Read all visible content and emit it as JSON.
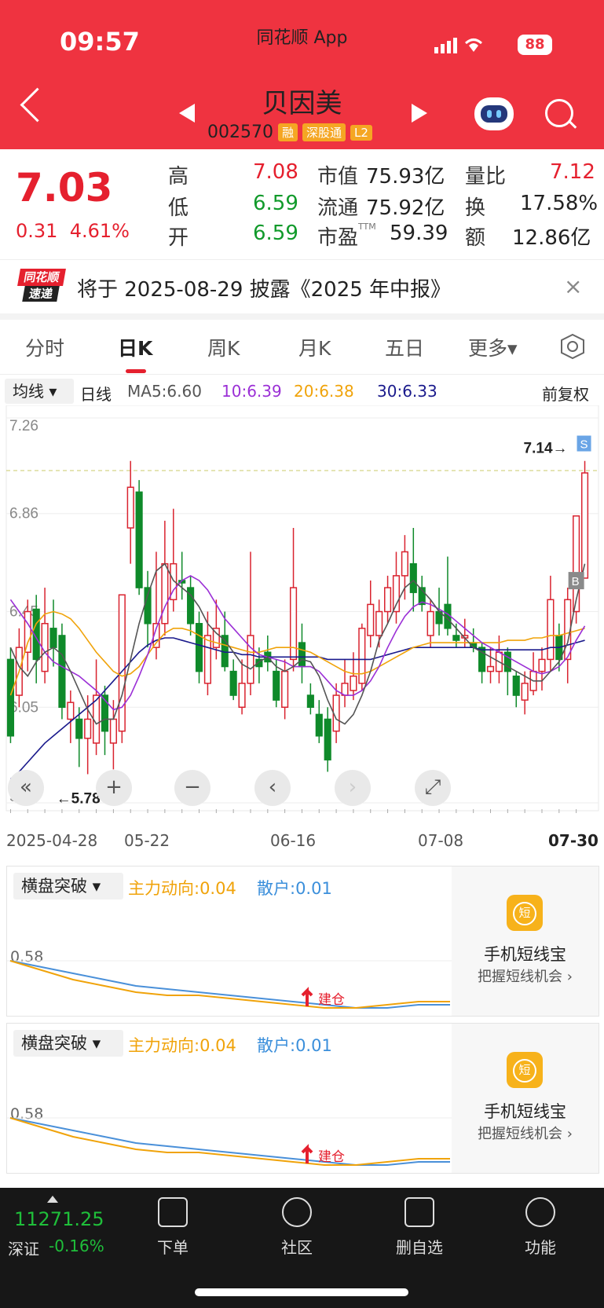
{
  "status_bar": {
    "time": "09:57",
    "battery": "88",
    "app": "同花顺 App"
  },
  "header": {
    "name": "贝因美",
    "code": "002570",
    "tags": [
      "融",
      "深股通",
      "L2"
    ]
  },
  "quote": {
    "price": "7.03",
    "change": "0.31",
    "change_pct": "4.61%",
    "high_label": "高",
    "high": "7.08",
    "low_label": "低",
    "low": "6.59",
    "open_label": "开",
    "open": "6.59",
    "mcap_label": "市值",
    "mcap": "75.93亿",
    "float_label": "流通",
    "float": "75.92亿",
    "pe_label": "市盈",
    "pe_sup": "TTM",
    "pe": "59.39",
    "vol_ratio_label": "量比",
    "vol_ratio": "7.12",
    "turnover_label": "换",
    "turnover": "17.58%",
    "amount_label": "额",
    "amount": "12.86亿"
  },
  "notice": {
    "logo_top": "同花顺",
    "logo_bottom": "速递",
    "text": "将于 2025-08-29 披露《2025 年中报》",
    "close": "×"
  },
  "tabs": [
    "分时",
    "日K",
    "周K",
    "月K",
    "五日",
    "更多▾"
  ],
  "ma_bar": {
    "selector": "均线",
    "period": "日线",
    "ma5": "MA5:6.60",
    "ma10": "10:6.39",
    "ma20": "20:6.38",
    "ma30": "30:6.33",
    "adjust": "前复权",
    "colors": {
      "ma5": "#555555",
      "ma10": "#9b2fd6",
      "ma20": "#f0a30a",
      "ma30": "#1a1a8c"
    }
  },
  "chart_data": {
    "type": "candlestick",
    "y_ticks": [
      "7.26",
      "6.86",
      "6.45",
      "6.05",
      "5.65"
    ],
    "x_labels": [
      "2025-04-28",
      "05-22",
      "06-16",
      "07-08",
      "07-30"
    ],
    "max_marker": "7.14→",
    "min_marker": "←5.78",
    "reference_price": 7.04,
    "buy_marker": "B",
    "sell_marker": "S",
    "candles": [
      {
        "o": 6.25,
        "c": 5.93,
        "h": 6.3,
        "l": 5.9
      },
      {
        "o": 6.1,
        "c": 6.3,
        "h": 6.38,
        "l": 6.05
      },
      {
        "o": 6.28,
        "c": 6.45,
        "h": 6.5,
        "l": 6.2
      },
      {
        "o": 6.46,
        "c": 6.25,
        "h": 6.52,
        "l": 6.15
      },
      {
        "o": 6.2,
        "c": 6.4,
        "h": 6.55,
        "l": 6.15
      },
      {
        "o": 6.38,
        "c": 6.3,
        "h": 6.5,
        "l": 6.22
      },
      {
        "o": 6.35,
        "c": 6.05,
        "h": 6.4,
        "l": 6.0
      },
      {
        "o": 6.0,
        "c": 6.07,
        "h": 6.12,
        "l": 5.9
      },
      {
        "o": 6.0,
        "c": 5.92,
        "h": 6.05,
        "l": 5.8
      },
      {
        "o": 5.92,
        "c": 6.0,
        "h": 6.1,
        "l": 5.77
      },
      {
        "o": 5.9,
        "c": 6.1,
        "h": 6.25,
        "l": 5.85
      },
      {
        "o": 6.1,
        "c": 5.95,
        "h": 6.14,
        "l": 5.85
      },
      {
        "o": 5.9,
        "c": 6.0,
        "h": 6.08,
        "l": 5.79
      },
      {
        "o": 5.95,
        "c": 6.52,
        "h": 6.52,
        "l": 5.9
      },
      {
        "o": 6.8,
        "c": 6.97,
        "h": 7.08,
        "l": 6.65
      },
      {
        "o": 6.95,
        "c": 6.55,
        "h": 7.0,
        "l": 6.52
      },
      {
        "o": 6.55,
        "c": 6.4,
        "h": 6.62,
        "l": 6.3
      },
      {
        "o": 6.3,
        "c": 6.4,
        "h": 6.7,
        "l": 6.25
      },
      {
        "o": 6.4,
        "c": 6.65,
        "h": 6.83,
        "l": 6.35
      },
      {
        "o": 6.5,
        "c": 6.65,
        "h": 6.88,
        "l": 6.45
      },
      {
        "o": 6.58,
        "c": 6.57,
        "h": 6.7,
        "l": 6.5
      },
      {
        "o": 6.55,
        "c": 6.4,
        "h": 6.6,
        "l": 6.35
      },
      {
        "o": 6.4,
        "c": 6.2,
        "h": 6.45,
        "l": 6.15
      },
      {
        "o": 6.15,
        "c": 6.35,
        "h": 6.45,
        "l": 6.1
      },
      {
        "o": 6.3,
        "c": 6.38,
        "h": 6.5,
        "l": 6.25
      },
      {
        "o": 6.35,
        "c": 6.22,
        "h": 6.45,
        "l": 6.2
      },
      {
        "o": 6.2,
        "c": 6.1,
        "h": 6.25,
        "l": 6.08
      },
      {
        "o": 6.05,
        "c": 6.15,
        "h": 6.25,
        "l": 6.02
      },
      {
        "o": 6.15,
        "c": 6.35,
        "h": 6.7,
        "l": 6.1
      },
      {
        "o": 6.25,
        "c": 6.22,
        "h": 6.3,
        "l": 6.15
      },
      {
        "o": 6.28,
        "c": 6.24,
        "h": 6.35,
        "l": 6.2
      },
      {
        "o": 6.2,
        "c": 6.08,
        "h": 6.25,
        "l": 6.05
      },
      {
        "o": 6.05,
        "c": 6.2,
        "h": 6.25,
        "l": 6.0
      },
      {
        "o": 6.25,
        "c": 6.55,
        "h": 6.8,
        "l": 6.2
      },
      {
        "o": 6.32,
        "c": 6.22,
        "h": 6.4,
        "l": 6.15
      },
      {
        "o": 6.1,
        "c": 6.05,
        "h": 6.15,
        "l": 6.02
      },
      {
        "o": 6.02,
        "c": 5.93,
        "h": 6.08,
        "l": 5.9
      },
      {
        "o": 6.0,
        "c": 5.83,
        "h": 6.05,
        "l": 5.78
      },
      {
        "o": 5.95,
        "c": 6.1,
        "h": 6.15,
        "l": 5.9
      },
      {
        "o": 6.1,
        "c": 6.15,
        "h": 6.25,
        "l": 6.05
      },
      {
        "o": 6.12,
        "c": 6.18,
        "h": 6.28,
        "l": 6.08
      },
      {
        "o": 6.15,
        "c": 6.38,
        "h": 6.4,
        "l": 6.12
      },
      {
        "o": 6.35,
        "c": 6.48,
        "h": 6.58,
        "l": 6.3
      },
      {
        "o": 6.35,
        "c": 6.45,
        "h": 6.5,
        "l": 6.3
      },
      {
        "o": 6.45,
        "c": 6.55,
        "h": 6.6,
        "l": 6.4
      },
      {
        "o": 6.45,
        "c": 6.6,
        "h": 6.7,
        "l": 6.4
      },
      {
        "o": 6.6,
        "c": 6.7,
        "h": 6.77,
        "l": 6.5
      },
      {
        "o": 6.65,
        "c": 6.53,
        "h": 6.8,
        "l": 6.45
      },
      {
        "o": 6.55,
        "c": 6.48,
        "h": 6.6,
        "l": 6.45
      },
      {
        "o": 6.35,
        "c": 6.45,
        "h": 6.5,
        "l": 6.3
      },
      {
        "o": 6.45,
        "c": 6.4,
        "h": 6.55,
        "l": 6.35
      },
      {
        "o": 6.48,
        "c": 6.38,
        "h": 6.68,
        "l": 6.35
      },
      {
        "o": 6.35,
        "c": 6.33,
        "h": 6.4,
        "l": 6.3
      },
      {
        "o": 6.34,
        "c": 6.35,
        "h": 6.42,
        "l": 6.3
      },
      {
        "o": 6.32,
        "c": 6.3,
        "h": 6.38,
        "l": 6.28
      },
      {
        "o": 6.3,
        "c": 6.2,
        "h": 6.32,
        "l": 6.15
      },
      {
        "o": 6.2,
        "c": 6.22,
        "h": 6.3,
        "l": 6.15
      },
      {
        "o": 6.2,
        "c": 6.28,
        "h": 6.35,
        "l": 6.15
      },
      {
        "o": 6.28,
        "c": 6.2,
        "h": 6.3,
        "l": 6.1
      },
      {
        "o": 6.18,
        "c": 6.1,
        "h": 6.2,
        "l": 6.05
      },
      {
        "o": 6.08,
        "c": 6.15,
        "h": 6.2,
        "l": 6.02
      },
      {
        "o": 6.12,
        "c": 6.2,
        "h": 6.28,
        "l": 6.1
      },
      {
        "o": 6.2,
        "c": 6.25,
        "h": 6.3,
        "l": 6.12
      },
      {
        "o": 6.25,
        "c": 6.5,
        "h": 6.6,
        "l": 6.2
      },
      {
        "o": 6.35,
        "c": 6.25,
        "h": 6.4,
        "l": 6.2
      },
      {
        "o": 6.25,
        "c": 6.5,
        "h": 6.55,
        "l": 6.15
      },
      {
        "o": 6.45,
        "c": 6.85,
        "h": 6.85,
        "l": 6.4
      },
      {
        "o": 6.59,
        "c": 7.03,
        "h": 7.08,
        "l": 6.59
      }
    ],
    "ma5": [
      6.3,
      6.22,
      6.18,
      6.24,
      6.28,
      6.3,
      6.27,
      6.2,
      6.12,
      6.04,
      5.98,
      6.0,
      6.0,
      6.1,
      6.25,
      6.4,
      6.52,
      6.62,
      6.65,
      6.58,
      6.55,
      6.52,
      6.47,
      6.4,
      6.36,
      6.33,
      6.28,
      6.23,
      6.21,
      6.24,
      6.26,
      6.22,
      6.2,
      6.22,
      6.25,
      6.24,
      6.18,
      6.08,
      6.0,
      5.98,
      6.02,
      6.1,
      6.2,
      6.33,
      6.4,
      6.48,
      6.55,
      6.58,
      6.54,
      6.5,
      6.45,
      6.42,
      6.38,
      6.34,
      6.3,
      6.28,
      6.26,
      6.24,
      6.22,
      6.2,
      6.18,
      6.16,
      6.16,
      6.2,
      6.24,
      6.32,
      6.5,
      6.65
    ],
    "ma10": [
      6.5,
      6.45,
      6.4,
      6.34,
      6.28,
      6.24,
      6.22,
      6.2,
      6.18,
      6.15,
      6.12,
      6.08,
      6.04,
      6.05,
      6.1,
      6.18,
      6.27,
      6.38,
      6.47,
      6.54,
      6.58,
      6.6,
      6.58,
      6.54,
      6.48,
      6.42,
      6.38,
      6.34,
      6.3,
      6.27,
      6.26,
      6.25,
      6.24,
      6.22,
      6.22,
      6.22,
      6.2,
      6.16,
      6.12,
      6.1,
      6.1,
      6.12,
      6.16,
      6.22,
      6.3,
      6.37,
      6.43,
      6.47,
      6.49,
      6.48,
      6.46,
      6.44,
      6.41,
      6.38,
      6.35,
      6.32,
      6.3,
      6.28,
      6.26,
      6.24,
      6.22,
      6.2,
      6.19,
      6.2,
      6.22,
      6.26,
      6.33,
      6.39
    ],
    "ma20": [
      6.1,
      6.2,
      6.32,
      6.4,
      6.44,
      6.45,
      6.44,
      6.42,
      6.38,
      6.33,
      6.28,
      6.24,
      6.2,
      6.18,
      6.19,
      6.22,
      6.27,
      6.32,
      6.36,
      6.38,
      6.38,
      6.37,
      6.35,
      6.33,
      6.32,
      6.31,
      6.3,
      6.29,
      6.28,
      6.28,
      6.29,
      6.3,
      6.3,
      6.3,
      6.29,
      6.28,
      6.26,
      6.24,
      6.22,
      6.2,
      6.19,
      6.19,
      6.2,
      6.22,
      6.24,
      6.26,
      6.28,
      6.3,
      6.31,
      6.32,
      6.32,
      6.32,
      6.32,
      6.32,
      6.32,
      6.32,
      6.32,
      6.32,
      6.33,
      6.33,
      6.33,
      6.34,
      6.34,
      6.35,
      6.35,
      6.36,
      6.37,
      6.38
    ],
    "ma30": [
      5.75,
      5.78,
      5.82,
      5.86,
      5.9,
      5.93,
      5.96,
      5.99,
      6.02,
      6.05,
      6.08,
      6.12,
      6.16,
      6.2,
      6.24,
      6.28,
      6.31,
      6.33,
      6.34,
      6.34,
      6.33,
      6.32,
      6.31,
      6.3,
      6.29,
      6.28,
      6.28,
      6.27,
      6.27,
      6.26,
      6.26,
      6.26,
      6.26,
      6.26,
      6.26,
      6.26,
      6.26,
      6.25,
      6.25,
      6.25,
      6.25,
      6.25,
      6.25,
      6.26,
      6.27,
      6.28,
      6.29,
      6.3,
      6.3,
      6.3,
      6.3,
      6.3,
      6.3,
      6.3,
      6.3,
      6.29,
      6.29,
      6.29,
      6.29,
      6.29,
      6.29,
      6.29,
      6.29,
      6.3,
      6.3,
      6.31,
      6.32,
      6.33
    ]
  },
  "chart_controls": [
    "«",
    "+",
    "−",
    "‹",
    "›",
    "⤢"
  ],
  "indicator_panels": [
    {
      "selector": "横盘突破",
      "main_force": "主力动向:0.04",
      "retail": "散户:0.01",
      "level": "0.58",
      "signal": "建仓",
      "side_title": "手机短线宝",
      "side_sub": "把握短线机会 ›",
      "side_icon": "短",
      "main_force_series": [
        0.58,
        0.55,
        0.52,
        0.5,
        0.48,
        0.47,
        0.47,
        0.46,
        0.45,
        0.44,
        0.43,
        0.43,
        0.44,
        0.45,
        0.45
      ],
      "retail_series": [
        0.58,
        0.56,
        0.54,
        0.52,
        0.5,
        0.49,
        0.48,
        0.47,
        0.46,
        0.45,
        0.44,
        0.43,
        0.43,
        0.44,
        0.44
      ]
    },
    {
      "selector": "横盘突破",
      "main_force": "主力动向:0.04",
      "retail": "散户:0.01",
      "level": "0.58",
      "signal": "建仓",
      "side_title": "手机短线宝",
      "side_sub": "把握短线机会 ›",
      "side_icon": "短",
      "main_force_series": [
        0.58,
        0.55,
        0.52,
        0.5,
        0.48,
        0.47,
        0.47,
        0.46,
        0.45,
        0.44,
        0.43,
        0.43,
        0.44,
        0.45,
        0.45
      ],
      "retail_series": [
        0.58,
        0.56,
        0.54,
        0.52,
        0.5,
        0.49,
        0.48,
        0.47,
        0.46,
        0.45,
        0.44,
        0.43,
        0.43,
        0.44,
        0.44
      ]
    }
  ],
  "bottom_bar": {
    "index_value": "11271.25",
    "index_name": "深证",
    "index_change": "-0.16%",
    "nav": [
      "下单",
      "社区",
      "删自选",
      "功能"
    ]
  }
}
